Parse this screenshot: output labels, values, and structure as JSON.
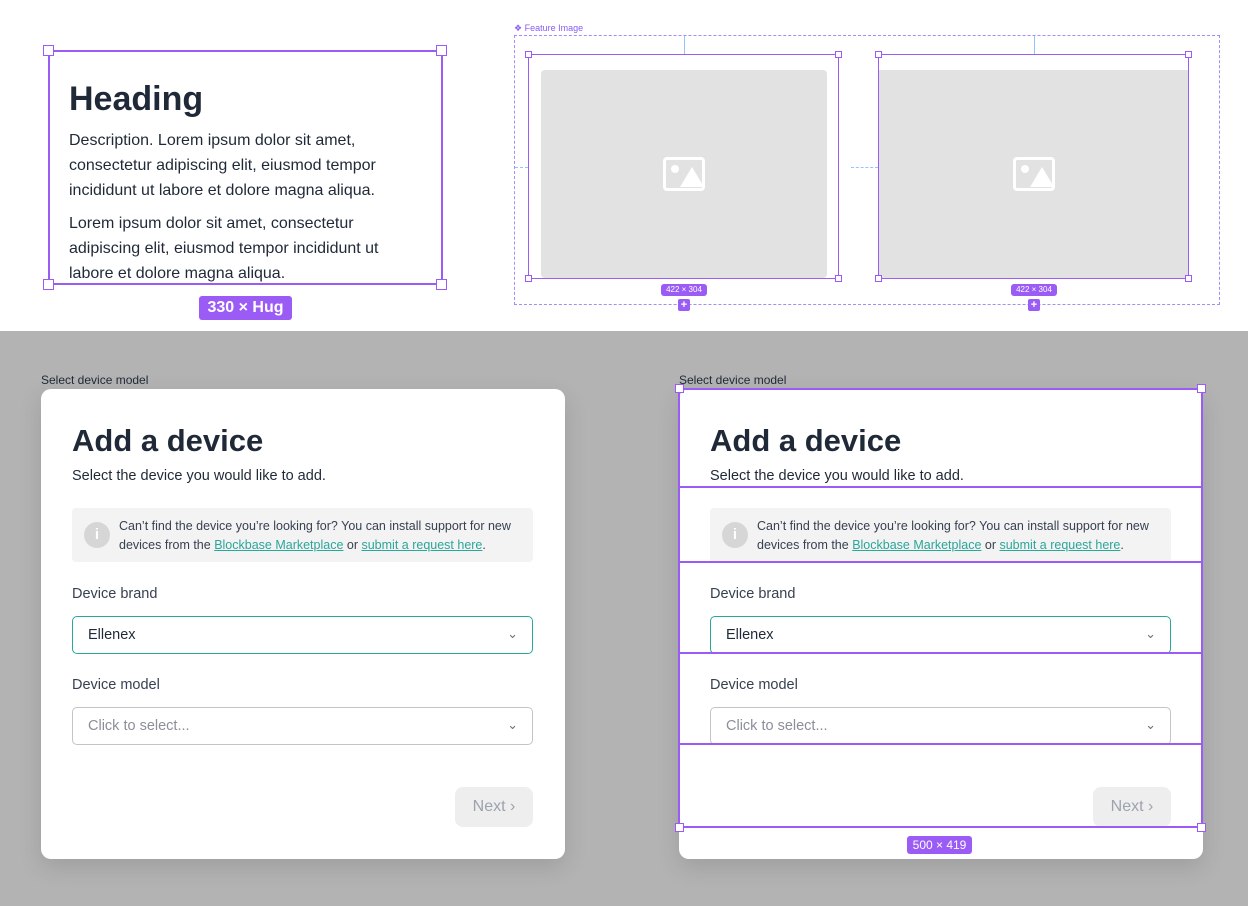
{
  "text_block": {
    "heading": "Heading",
    "para1": "Description. Lorem ipsum dolor sit amet, consectetur adipiscing elit, eiusmod tempor incididunt ut labore et dolore magna aliqua.",
    "para2": "Lorem ipsum dolor sit amet, consectetur adipiscing elit, eiusmod tempor incididunt ut labore et dolore magna aliqua.",
    "size_badge": "330 × Hug"
  },
  "feature_image": {
    "label": "❖ Feature Image",
    "left_badge": "422 × 304",
    "right_badge": "422 × 304",
    "plus": "+"
  },
  "left_frame": {
    "frame_label": "Select device model"
  },
  "right_frame": {
    "frame_label": "Select device model",
    "size_badge": "500 × 419"
  },
  "dialog": {
    "title": "Add a device",
    "subtitle": "Select the device you would like to add.",
    "info_icon": "i",
    "info_text_prefix": "Can’t find the device you’re looking for? You can install support for new devices from the ",
    "info_link1": "Blockbase Marketplace",
    "info_text_mid": " or ",
    "info_link2": "submit a request here",
    "info_text_suffix": ".",
    "brand_label": "Device brand",
    "brand_value": "Ellenex",
    "model_label": "Device model",
    "model_placeholder": "Click to select...",
    "chevron": "⌄",
    "next_label": "Next ›"
  },
  "colors": {
    "selection": "#9b5cf6",
    "accent_green": "#2aa69a",
    "canvas_gray": "#b3b3b3"
  }
}
